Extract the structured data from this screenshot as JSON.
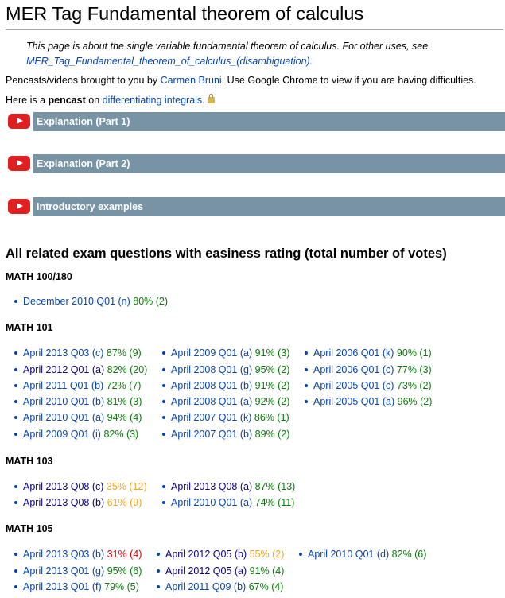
{
  "page": {
    "title": "MER Tag Fundamental theorem of calculus",
    "hatnote_text": "This page is about the single variable fundamental theorem of calculus. For other uses, see",
    "hatnote_link": "MER_Tag_Fundamental_theorem_of_calculus_(disambiguation).",
    "credit_prefix": "Pencasts/videos brought to you by",
    "credit_name": "Carmen Bruni",
    "credit_suffix": ". Use Google Chrome to view if you are having difficulties.",
    "pencast_prefix": "Here is a",
    "pencast_bold": "pencast",
    "pencast_mid": "on",
    "pencast_link": "differentiating integrals."
  },
  "videos": [
    {
      "label": "Explanation (Part 1)"
    },
    {
      "label": "Explanation (Part 2)"
    },
    {
      "label": "Introductory examples"
    }
  ],
  "exams_heading": "All related exam questions with easiness rating (total number of votes)",
  "courses": [
    {
      "name": "MATH 100/180"
    },
    {
      "name": "MATH 101"
    },
    {
      "name": "MATH 103"
    },
    {
      "name": "MATH 105"
    }
  ],
  "items": [
    {
      "q": "December 2010 Q01 (n)",
      "r": "80% (2)"
    },
    {
      "q": "April 2013 Q03 (c)",
      "r": "87% (9)"
    },
    {
      "q": "April 2009 Q01 (a)",
      "r": "91% (3)"
    },
    {
      "q": "April 2006 Q01 (k)",
      "r": "90% (1)"
    },
    {
      "q": "April 2012 Q01 (a)",
      "r": "82% (20)"
    },
    {
      "q": "April 2008 Q01 (g)",
      "r": "95% (2)"
    },
    {
      "q": "April 2006 Q01 (c)",
      "r": "77% (3)"
    },
    {
      "q": "April 2011 Q01 (b)",
      "r": "72% (7)"
    },
    {
      "q": "April 2008 Q01 (b)",
      "r": "91% (2)"
    },
    {
      "q": "April 2005 Q01 (c)",
      "r": "73% (2)"
    },
    {
      "q": "April 2010 Q01 (b)",
      "r": "81% (3)"
    },
    {
      "q": "April 2008 Q01 (a)",
      "r": "92% (2)"
    },
    {
      "q": "April 2005 Q01 (a)",
      "r": "96% (2)"
    },
    {
      "q": "April 2010 Q01 (a)",
      "r": "94% (4)"
    },
    {
      "q": "April 2007 Q01 (k)",
      "r": "86% (1)"
    },
    {
      "q": "April 2009 Q01 (i)",
      "r": "82% (3)"
    },
    {
      "q": "April 2007 Q01 (b)",
      "r": "89% (2)"
    },
    {
      "q": "April 2013 Q08 (c)",
      "r": "35% (12)"
    },
    {
      "q": "April 2013 Q08 (a)",
      "r": "87% (13)"
    },
    {
      "q": "April 2013 Q08 (b)",
      "r": "61% (9)"
    },
    {
      "q": "April 2010 Q01 (a)",
      "r": "74% (11)"
    },
    {
      "q": "April 2013 Q03 (b)",
      "r": "31% (4)"
    },
    {
      "q": "April 2012 Q05 (b)",
      "r": "55% (2)"
    },
    {
      "q": "April 2010 Q01 (d)",
      "r": "82% (6)"
    },
    {
      "q": "April 2013 Q01 (g)",
      "r": "95% (6)"
    },
    {
      "q": "April 2012 Q05 (a)",
      "r": "91% (4)"
    },
    {
      "q": "April 2013 Q01 (f)",
      "r": "79% (5)"
    },
    {
      "q": "April 2011 Q09 (b)",
      "r": "67% (4)"
    }
  ],
  "colors": {
    "link": "#0645ad",
    "visited": "#0b0080",
    "good": "#0b7a0b",
    "medium": "#f5a623",
    "poor": "#e00000",
    "bar": "#7893a4"
  }
}
